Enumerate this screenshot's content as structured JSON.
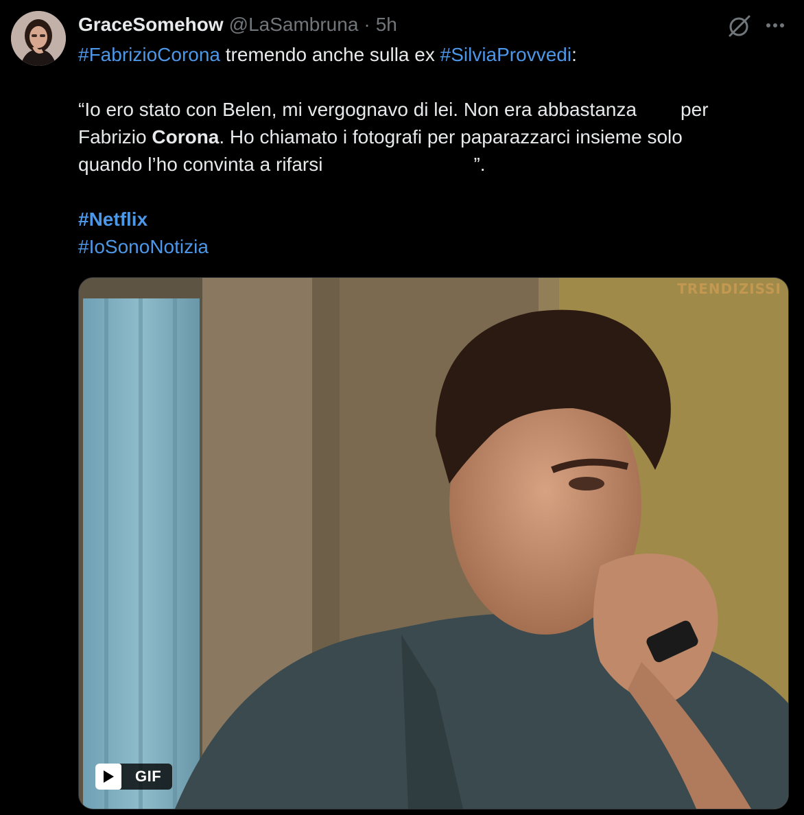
{
  "tweet": {
    "author": {
      "display_name": "GraceSomehow",
      "handle": "@LaSambruna",
      "separator": "·",
      "time": "5h"
    },
    "text": {
      "line1_tag1": "#FabrizioCorona",
      "line1_mid": " tremendo anche sulla ex ",
      "line1_tag2": "#SilviaProvvedi",
      "line1_end": ":",
      "quote_line1_a": "“Io ero stato con Belen, mi vergognavo di lei. Non era abbastanza",
      "quote_line1_b": "per",
      "quote_line2_a": "Fabrizio ",
      "quote_line2_bold": "Corona",
      "quote_line2_b": ". Ho chiamato i fotografi per paparazzarci insieme solo",
      "quote_line3_a": "quando l’ho convinta a rifarsi",
      "quote_line3_b": "”.",
      "hashtag_netflix": "#Netflix",
      "hashtag_iosono": "#IoSonoNotizia"
    },
    "media": {
      "watermark": "TRENDIZISSI",
      "badge_label": "GIF"
    },
    "icons": {
      "grok": "grok-icon",
      "more": "more-icon",
      "play": "play-icon"
    },
    "colors": {
      "background": "#000000",
      "text": "#e7e9ea",
      "secondary": "#71767b",
      "link": "#4d97e8"
    }
  }
}
